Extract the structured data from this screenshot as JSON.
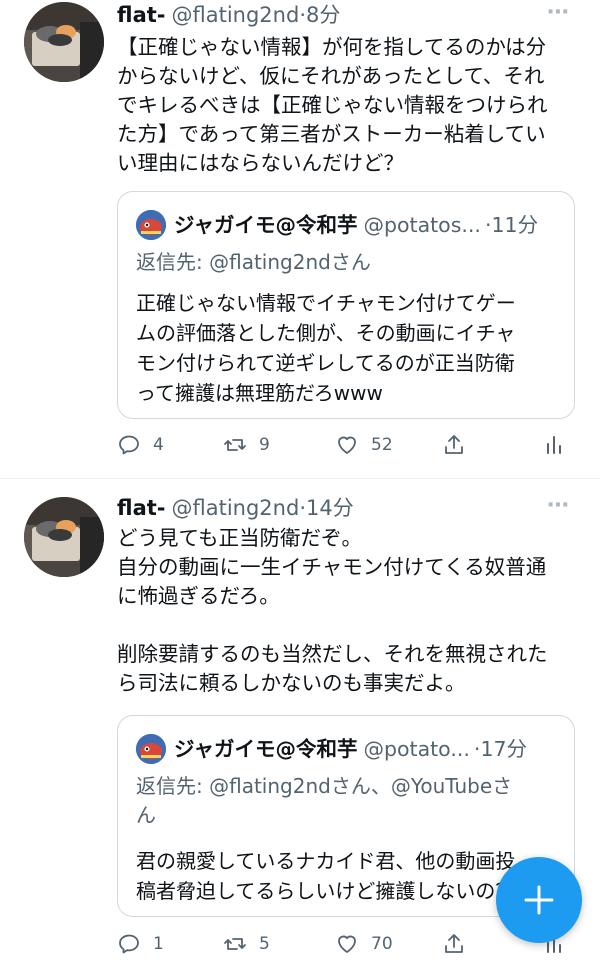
{
  "colors": {
    "accent": "#1d9bf0",
    "text_primary": "#0f1419",
    "text_secondary": "#536471",
    "border": "#cfd9de"
  },
  "tweets": [
    {
      "author_name": "flat-",
      "handle": "@flating2nd",
      "separator": "·",
      "time": "8分",
      "more_icon": "⋯",
      "text": "【正確じゃない情報】が何を指してるのかは分\nからないけど、仮にそれがあったとして、それ\nでキレるべきは【正確じゃない情報をつけられ\nた方】であって第三者がストーカー粘着してい\nい理由にはならないんだけど？",
      "quote": {
        "author_name": "ジャガイモ@令和芋",
        "handle": "@potatos...",
        "separator": "·",
        "time": "11分",
        "reply_to": "返信先: @flating2ndさん",
        "text": "正確じゃない情報でイチャモン付けてゲー\nムの評価落とした側が、その動画にイチャ\nモン付けられて逆ギレしてるのが正当防衛\nって擁護は無理筋だろwww"
      },
      "actions": {
        "replies": "4",
        "retweets": "9",
        "likes": "52"
      }
    },
    {
      "author_name": "flat-",
      "handle": "@flating2nd",
      "separator": "·",
      "time": "14分",
      "more_icon": "⋯",
      "text": "どう見ても正当防衛だぞ。\n自分の動画に一生イチャモン付けてくる奴普通\nに怖過ぎるだろ。\n\n削除要請するのも当然だし、それを無視された\nら司法に頼るしかないのも事実だよ。",
      "quote": {
        "author_name": "ジャガイモ@令和芋",
        "handle": "@potato...",
        "separator": "·",
        "time": "17分",
        "reply_to": "返信先: @flating2ndさん、@YouTubeさ\nん",
        "text": "君の親愛しているナカイド君、他の動画投\n稿者脅迫してるらしいけど擁護しないの？"
      },
      "actions": {
        "replies": "1",
        "retweets": "5",
        "likes": "70"
      }
    }
  ],
  "fab": {
    "icon": "plus-icon",
    "label": "compose-tweet"
  }
}
